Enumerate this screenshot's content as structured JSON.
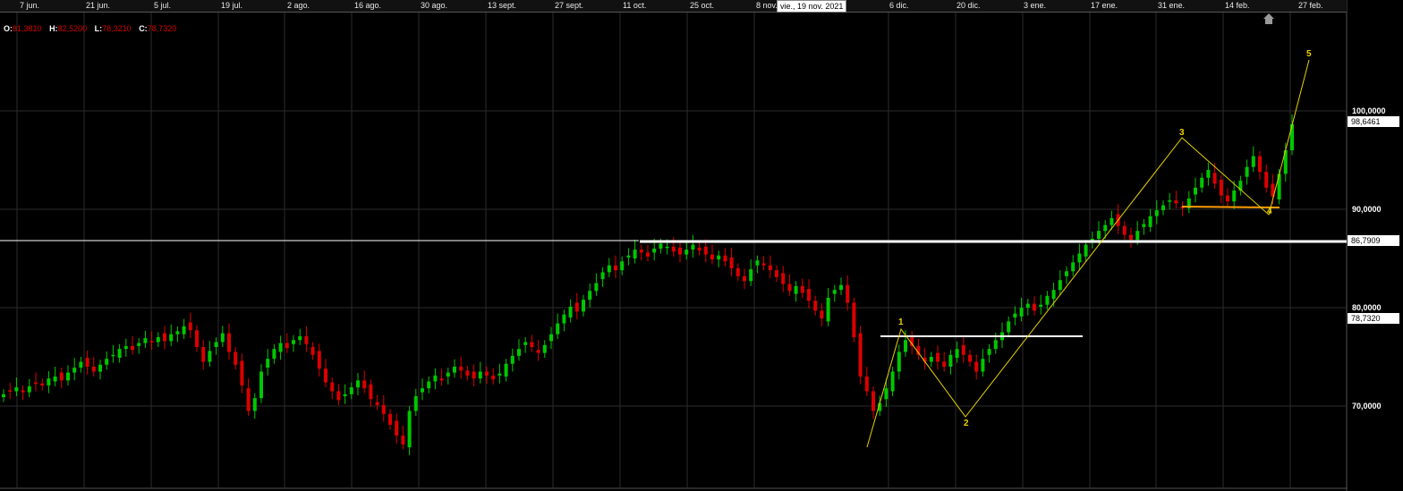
{
  "chart_data": {
    "type": "candlestick",
    "x_axis_labels": [
      "7 jun.",
      "21 jun.",
      "5 jul.",
      "19 jul.",
      "2 ago.",
      "16 ago.",
      "30 ago.",
      "13 sept.",
      "27 sept.",
      "11 oct.",
      "25 oct.",
      "8 nov.",
      "6 dic.",
      "20 dic.",
      "3 ene.",
      "17 ene.",
      "31 ene.",
      "14 feb.",
      "27 feb."
    ],
    "y_axis_labels": [
      "100,0000",
      "90,0000",
      "80,0000",
      "70,0000"
    ],
    "y_ticks": [
      100,
      90,
      80,
      70
    ],
    "ylim": [
      60.9,
      111.3
    ],
    "crosshair_date": "vie., 19 nov. 2021",
    "ohlc": {
      "o_label": "O:",
      "o": "81,3810",
      "h_label": "H:",
      "h": "82,5200",
      "l_label": "L:",
      "l": "78,3210",
      "c_label": "C:",
      "c": "78,7320"
    },
    "price_boxes": [
      {
        "label": "98,6461",
        "value": 98.65
      },
      {
        "label": "86,7909",
        "value": 86.79
      },
      {
        "label": "78,7320",
        "value": 78.73
      }
    ],
    "closes": [
      71.2,
      71.5,
      71.9,
      71.4,
      72.0,
      72.3,
      72.1,
      72.8,
      73.0,
      72.6,
      73.4,
      73.9,
      74.5,
      74.0,
      73.5,
      74.2,
      74.8,
      75.2,
      75.8,
      76.1,
      75.7,
      76.4,
      76.9,
      76.5,
      77.0,
      76.6,
      77.3,
      77.6,
      78.1,
      77.7,
      76.0,
      74.5,
      75.6,
      76.5,
      77.4,
      75.5,
      74.2,
      72.1,
      69.5,
      70.8,
      73.5,
      74.8,
      75.8,
      76.4,
      75.9,
      76.7,
      77.1,
      76.3,
      75.2,
      73.8,
      72.4,
      71.5,
      70.6,
      71.2,
      71.9,
      72.6,
      71.8,
      70.7,
      70.1,
      69.2,
      68.1,
      67.0,
      66.1,
      69.5,
      71.0,
      71.8,
      72.5,
      73.1,
      72.6,
      73.4,
      74.0,
      73.6,
      73.1,
      72.8,
      73.5,
      73.1,
      72.7,
      73.3,
      74.3,
      75.1,
      75.8,
      76.5,
      76.0,
      75.4,
      76.2,
      77.3,
      78.4,
      79.3,
      80.1,
      79.6,
      80.8,
      81.7,
      82.5,
      83.6,
      84.3,
      83.8,
      84.7,
      85.3,
      85.9,
      85.6,
      85.2,
      86.0,
      86.5,
      86.2,
      85.7,
      85.4,
      85.9,
      86.4,
      85.8,
      85.4,
      84.9,
      85.3,
      84.7,
      84.0,
      83.2,
      82.7,
      83.9,
      84.8,
      84.3,
      83.8,
      83.1,
      82.4,
      81.7,
      82.2,
      81.5,
      80.7,
      79.7,
      78.9,
      81.0,
      81.8,
      82.3,
      80.5,
      77.0,
      73.0,
      71.5,
      69.5,
      70.3,
      71.8,
      73.5,
      75.5,
      76.7,
      76.1,
      75.2,
      74.5,
      75.0,
      74.5,
      74.0,
      75.2,
      75.8,
      75.2,
      74.5,
      73.5,
      74.8,
      75.8,
      76.7,
      77.5,
      78.6,
      79.4,
      80.0,
      80.4,
      79.7,
      80.3,
      81.2,
      81.8,
      82.8,
      83.7,
      84.6,
      85.5,
      86.4,
      87.0,
      87.8,
      88.4,
      89.1,
      88.3,
      87.4,
      86.9,
      87.8,
      88.5,
      89.3,
      89.9,
      90.4,
      90.9,
      90.6,
      90.1,
      91.1,
      92.2,
      93.2,
      94.0,
      92.6,
      91.4,
      90.8,
      91.9,
      92.9,
      94.3,
      95.4,
      93.8,
      92.2,
      91.3,
      93.6,
      96.0,
      98.65
    ],
    "pattern_wave_label_1": "1",
    "pattern_wave_label_2": "2",
    "pattern_wave_label_3": "3",
    "pattern_wave_label_4": "4",
    "pattern_wave_label_5": "5"
  },
  "colors": {
    "up": "#00c800",
    "down": "#dc0000",
    "wave": "#e6d200",
    "wave_label": "#f0d000",
    "support": "#ffffff",
    "orange_line": "#ff9c00",
    "grid": "#2b2b2b"
  }
}
